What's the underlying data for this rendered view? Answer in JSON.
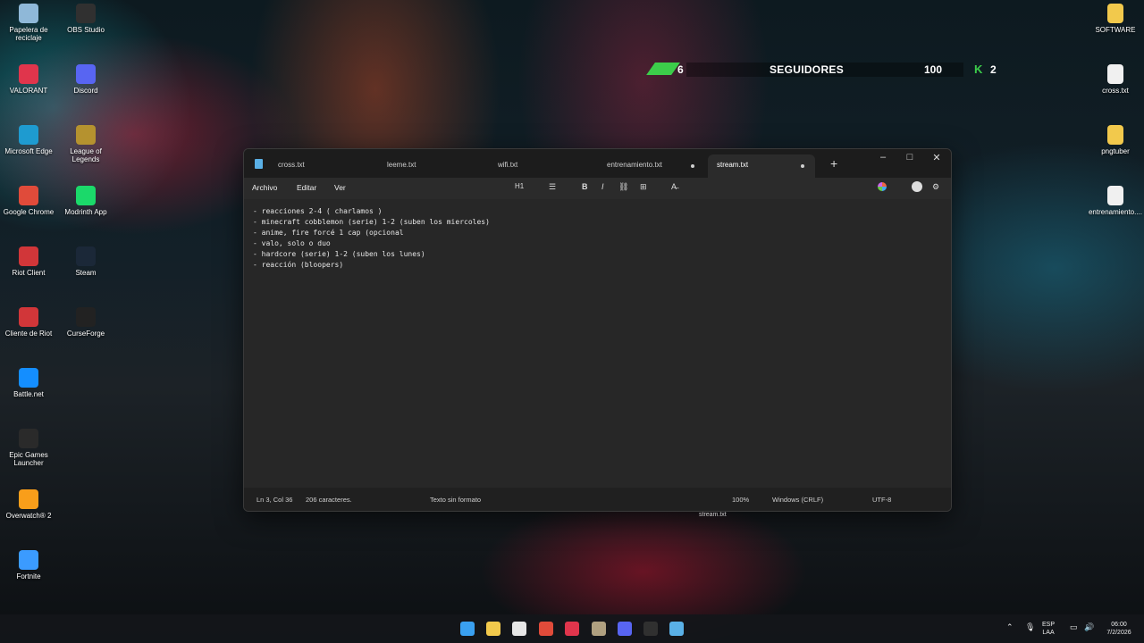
{
  "desktop": {
    "left_icons": [
      {
        "label": "Papelera de reciclaje",
        "icon": "recycle-bin-icon",
        "color": "#8fb8d8"
      },
      {
        "label": "OBS Studio",
        "icon": "obs-icon",
        "color": "#303030"
      },
      {
        "label": "VALORANT",
        "icon": "valorant-icon",
        "color": "#e0354c"
      },
      {
        "label": "Discord",
        "icon": "discord-icon",
        "color": "#5865f2"
      },
      {
        "label": "Microsoft Edge",
        "icon": "edge-icon",
        "color": "#1e9bd0"
      },
      {
        "label": "League of Legends",
        "icon": "league-icon",
        "color": "#b5922f"
      },
      {
        "label": "Google Chrome",
        "icon": "chrome-icon",
        "color": "#e04b3a"
      },
      {
        "label": "Modrinth App",
        "icon": "modrinth-icon",
        "color": "#1bd96a"
      },
      {
        "label": "Riot Client",
        "icon": "riot-icon",
        "color": "#d13639"
      },
      {
        "label": "Steam",
        "icon": "steam-icon",
        "color": "#1b2838"
      },
      {
        "label": "Cliente de Riot",
        "icon": "riot-icon",
        "color": "#d13639"
      },
      {
        "label": "CurseForge",
        "icon": "curseforge-icon",
        "color": "#222222"
      },
      {
        "label": "Battle.net",
        "icon": "battlenet-icon",
        "color": "#148eff"
      },
      {
        "label": "Epic Games Launcher",
        "icon": "epic-icon",
        "color": "#2a2a2a"
      },
      {
        "label": "Overwatch® 2",
        "icon": "overwatch-icon",
        "color": "#f99e1a"
      },
      {
        "label": "Fortnite",
        "icon": "fortnite-icon",
        "color": "#3b9bff"
      }
    ],
    "right_icons": [
      {
        "label": "SOFTWARE",
        "icon": "folder-icon",
        "color": "#f2c94c"
      },
      {
        "label": "cross.txt",
        "icon": "text-file-icon",
        "color": "#f0f0f0"
      },
      {
        "label": "pngtuber",
        "icon": "folder-icon",
        "color": "#f2c94c"
      },
      {
        "label": "entrenamiento....",
        "icon": "text-file-icon",
        "color": "#f0f0f0"
      }
    ]
  },
  "overlay": {
    "count": "6",
    "title": "SEGUIDORES",
    "goal": "100",
    "k_symbol": "K",
    "k_value": "2"
  },
  "notepad": {
    "tabs": [
      {
        "label": "cross.txt",
        "modified": false,
        "active": false
      },
      {
        "label": "leeme.txt",
        "modified": false,
        "active": false
      },
      {
        "label": "wifi.txt",
        "modified": false,
        "active": false
      },
      {
        "label": "entrenamiento.txt",
        "modified": true,
        "active": false
      },
      {
        "label": "stream.txt",
        "modified": true,
        "active": true
      }
    ],
    "new_tab": "+",
    "window_controls": {
      "minimize": "–",
      "maximize": "□",
      "close": "✕"
    },
    "menu": {
      "file": "Archivo",
      "edit": "Editar",
      "view": "Ver"
    },
    "toolbar": {
      "heading": "H1",
      "list": "☰",
      "bold": "B",
      "italic": "I",
      "link": "⛓",
      "table": "⊞",
      "clear": "A̶"
    },
    "lines": [
      "- reacciones 2-4 ( charlamos )",
      "- minecraft cobblemon (serie) 1-2 (suben los miercoles)",
      "- anime, fire forcé 1 cap (opcional",
      "- valo, solo o duo",
      "- hardcore (serie) 1-2 (suben los lunes)",
      "- reacción (bloopers)"
    ],
    "status": {
      "position": "Ln 3, Col 36",
      "chars": "206 caracteres.",
      "format": "Texto sin formato",
      "zoom": "100%",
      "eol": "Windows (CRLF)",
      "encoding": "UTF-8"
    },
    "taskbar_preview": "stream.txt"
  },
  "taskbar": {
    "apps": [
      {
        "icon": "windows-start-icon",
        "color": "#3aa0f0"
      },
      {
        "icon": "file-explorer-icon",
        "color": "#f2c94c"
      },
      {
        "icon": "microsoft-store-icon",
        "color": "#e6e6e6"
      },
      {
        "icon": "chrome-icon",
        "color": "#e04b3a"
      },
      {
        "icon": "valorant-icon",
        "color": "#e0354c"
      },
      {
        "icon": "app-icon",
        "color": "#b0a080"
      },
      {
        "icon": "discord-icon",
        "color": "#5865f2"
      },
      {
        "icon": "obs-icon",
        "color": "#303030"
      },
      {
        "icon": "notepad-icon",
        "color": "#5ab0e6"
      }
    ],
    "tray": {
      "lang_line1": "ESP",
      "lang_line2": "LAA",
      "time": "06:00",
      "date": "7/2/2026"
    }
  }
}
